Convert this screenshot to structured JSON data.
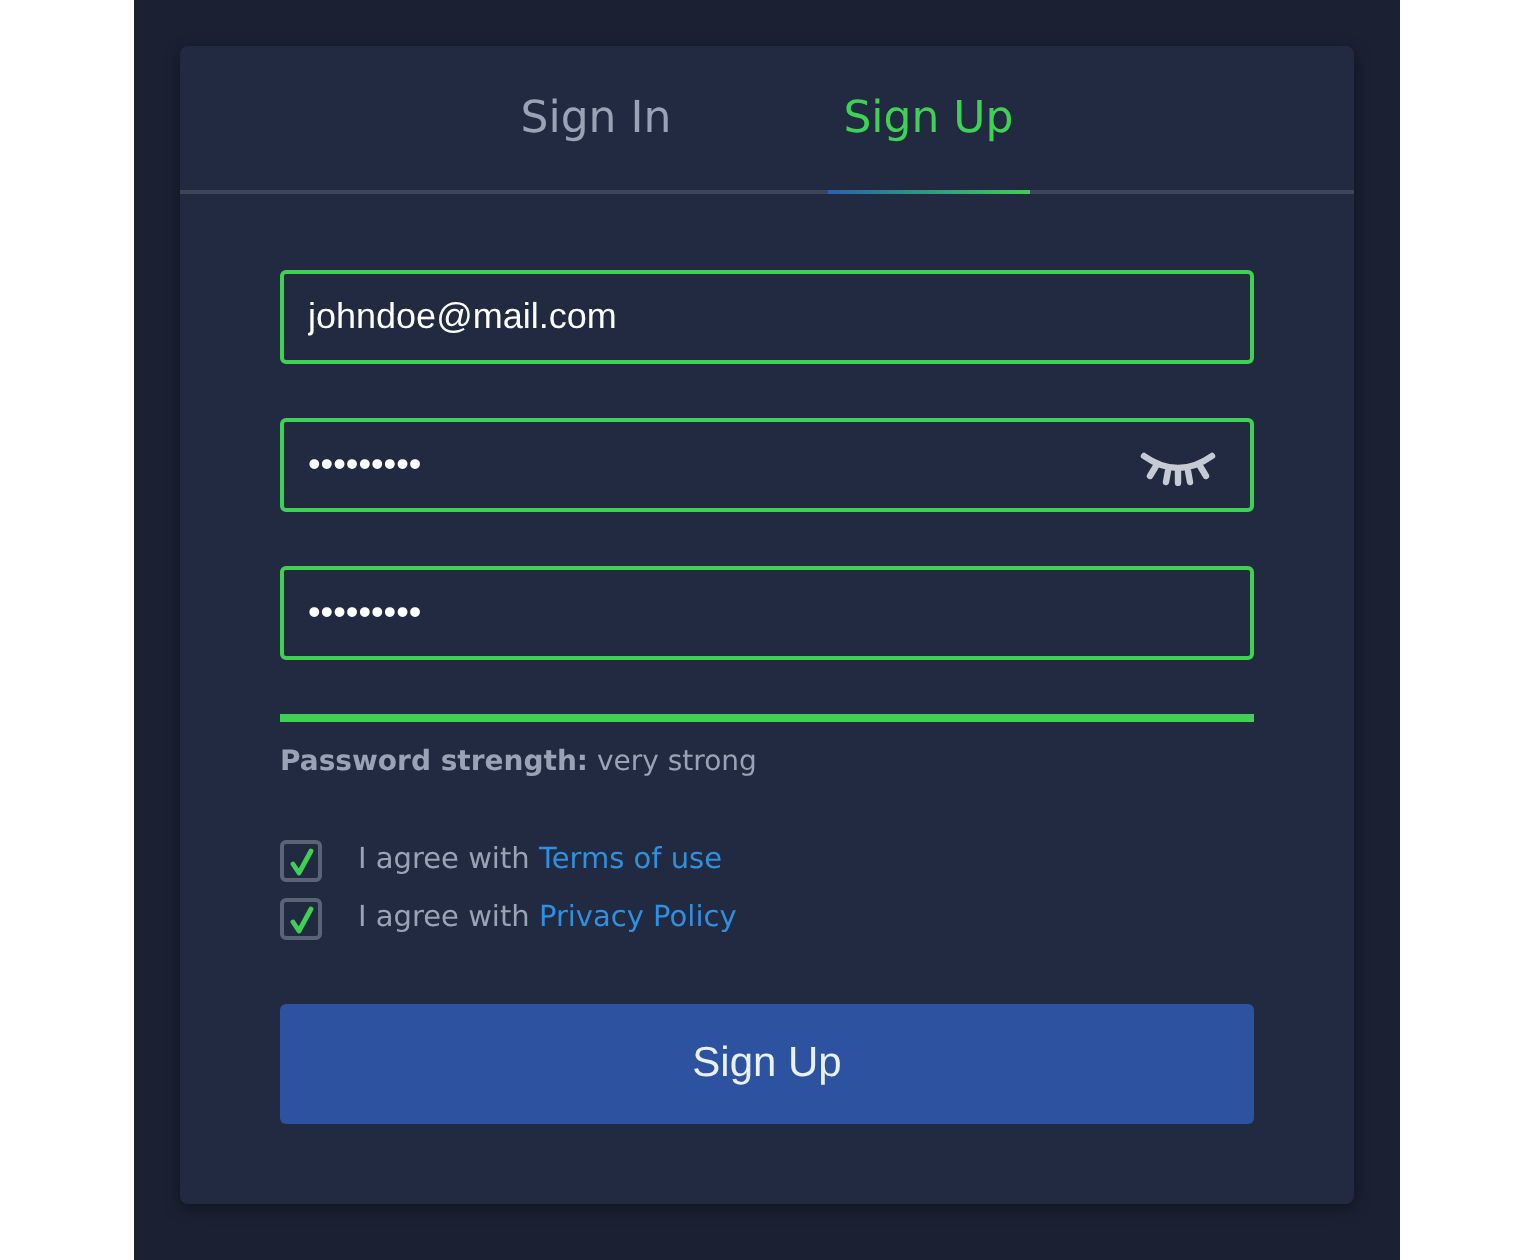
{
  "tabs": [
    {
      "label": "Sign In",
      "selected": false
    },
    {
      "label": "Sign Up",
      "selected": true
    }
  ],
  "fields": [
    {
      "kind": "text",
      "value": "johndoe@mail.com"
    },
    {
      "kind": "password-toggle",
      "value": "•••••••••"
    },
    {
      "kind": "password",
      "value": "•••••••••"
    }
  ],
  "strength": {
    "level": 1,
    "text": "**Password strength:** very strong"
  },
  "agreements": [
    {
      "checked": true,
      "text": "I agree with",
      "link": "Terms of use"
    },
    {
      "checked": true,
      "text": "I agree with",
      "link": "Privacy Policy"
    }
  ],
  "submit": "Sign Up"
}
